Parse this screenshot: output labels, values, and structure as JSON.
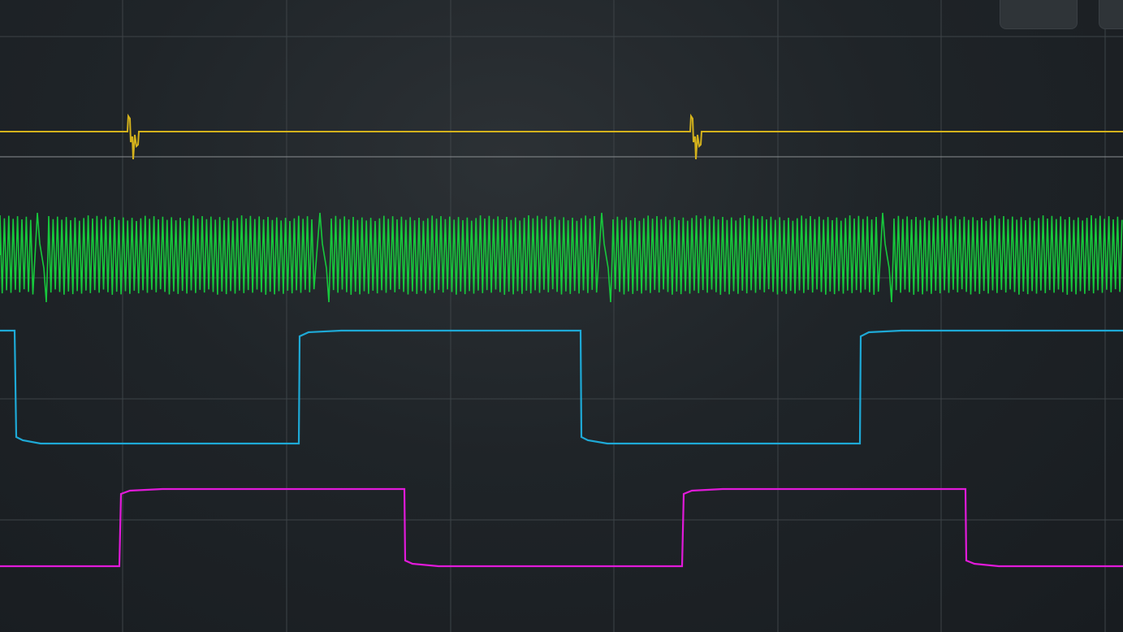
{
  "app": {
    "title": "",
    "background": "#1f2428"
  },
  "display": {
    "grid": true,
    "grid_color": "#3d4347",
    "reference_line_color": "#8a8e91",
    "vertical_divisions": 7,
    "horizontal_divisions": 5
  },
  "channels": [
    {
      "name": "",
      "color": "#d4b21c",
      "signal": "pulse-glitch"
    },
    {
      "name": "",
      "color": "#17c93c",
      "signal": "burst"
    },
    {
      "name": "",
      "color": "#1ea9d6",
      "signal": "square"
    },
    {
      "name": "",
      "color": "#e11ad9",
      "signal": "square"
    }
  ],
  "controls": {
    "btn_a_icon": "circle-icon",
    "btn_b_icon": ""
  }
}
